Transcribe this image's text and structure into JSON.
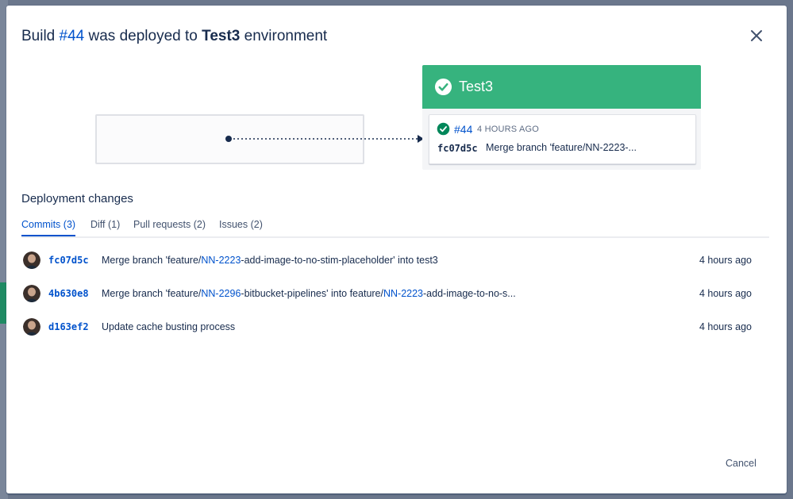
{
  "modal": {
    "title_prefix": "Build",
    "title_build": "#44",
    "title_middle": "was deployed to",
    "title_env": "Test3",
    "title_suffix": "environment"
  },
  "environment": {
    "name": "Test3",
    "status_color": "#36b37e",
    "build_number": "#44",
    "deployed_time": "4 HOURS AGO",
    "commit_hash": "fc07d5c",
    "commit_message": "Merge branch 'feature/NN-2223-..."
  },
  "deployment_changes": {
    "heading": "Deployment changes",
    "tabs": [
      {
        "label": "Commits (3)",
        "active": true
      },
      {
        "label": "Diff (1)",
        "active": false
      },
      {
        "label": "Pull requests (2)",
        "active": false
      },
      {
        "label": "Issues (2)",
        "active": false
      }
    ],
    "commits": [
      {
        "hash": "fc07d5c",
        "message_parts": [
          "Merge branch 'feature/",
          "NN-2223",
          "-add-image-to-no-stim-placeholder' into test3"
        ],
        "time": "4 hours ago"
      },
      {
        "hash": "4b630e8",
        "message_parts": [
          "Merge branch 'feature/",
          "NN-2296",
          "-bitbucket-pipelines' into feature/",
          "NN-2223",
          "-add-image-to-no-s..."
        ],
        "time": "4 hours ago"
      },
      {
        "hash": "d163ef2",
        "message_parts": [
          "Update cache busting process"
        ],
        "time": "4 hours ago"
      }
    ]
  },
  "footer": {
    "cancel_label": "Cancel"
  },
  "icons": {
    "close": "close-icon",
    "check": "check-circle-icon",
    "avatar": "user-avatar"
  }
}
